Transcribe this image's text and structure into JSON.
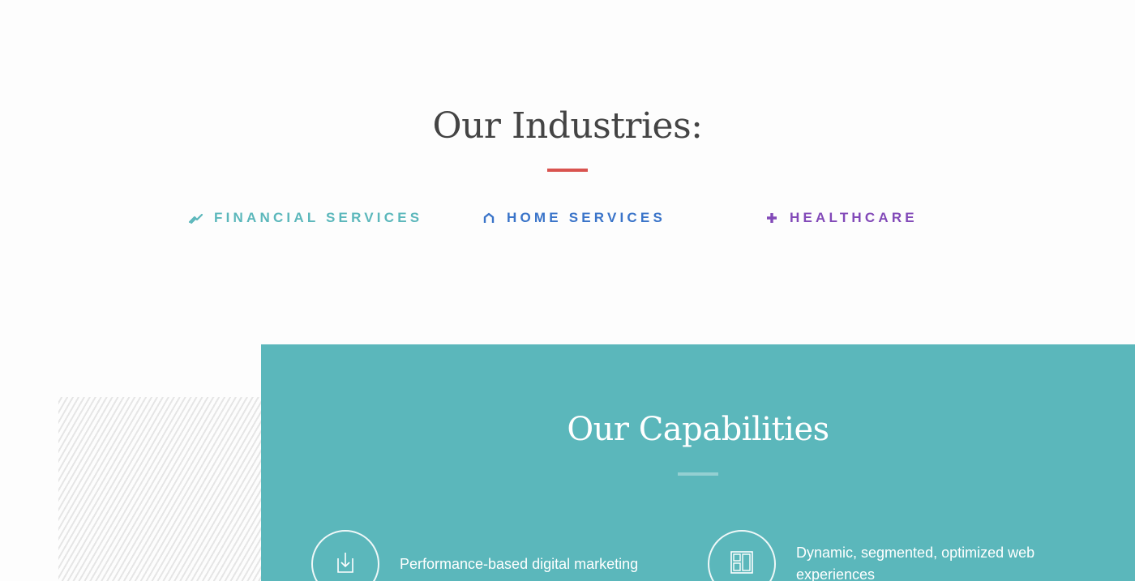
{
  "industries": {
    "title": "Our Industries:",
    "accent_color": "#d9534f",
    "items": [
      {
        "label": "FINANCIAL SERVICES",
        "icon": "trend-lines-icon",
        "color": "#5bb7bb"
      },
      {
        "label": "HOME SERVICES",
        "icon": "house-icon",
        "color": "#3a74c9"
      },
      {
        "label": "HEALTHCARE",
        "icon": "plus-icon",
        "color": "#8249b8"
      }
    ]
  },
  "capabilities": {
    "title": "Our Capabilities",
    "background_color": "#5bb7bb",
    "items": [
      {
        "text": "Performance-based digital marketing",
        "icon": "download-box-icon"
      },
      {
        "text": "Dynamic, segmented, optimized web experiences",
        "icon": "layout-panels-icon"
      }
    ]
  }
}
